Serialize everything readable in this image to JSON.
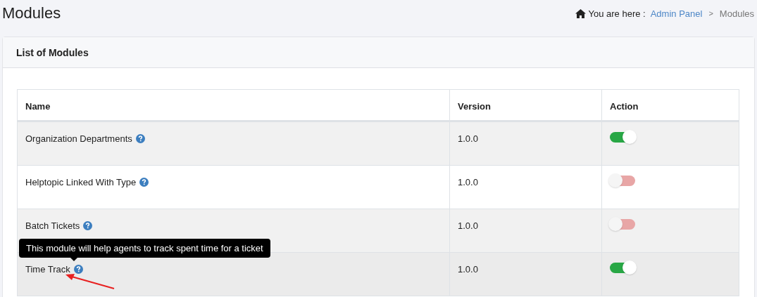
{
  "page_title": "Modules",
  "breadcrumb": {
    "prefix": "You are here :",
    "items": [
      {
        "label": "Admin Panel",
        "link": true
      },
      {
        "label": "Modules",
        "link": false
      }
    ],
    "separator": ">"
  },
  "card": {
    "title": "List of Modules"
  },
  "table": {
    "columns": [
      "Name",
      "Version",
      "Action"
    ],
    "rows": [
      {
        "name": "Organization Departments",
        "version": "1.0.0",
        "on": true
      },
      {
        "name": "Helptopic Linked With Type",
        "version": "1.0.0",
        "on": false
      },
      {
        "name": "Batch Tickets",
        "version": "1.0.0",
        "on": false
      },
      {
        "name": "Time Track",
        "version": "1.0.0",
        "on": true,
        "tooltip": "This module will help agents to track spent time for a ticket"
      }
    ]
  }
}
